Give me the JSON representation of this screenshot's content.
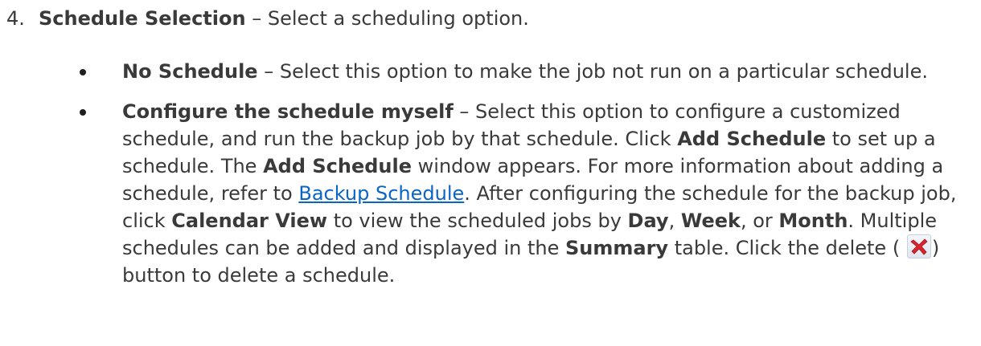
{
  "step": {
    "number": "4.",
    "title": "Schedule Selection",
    "text": " – Select a scheduling option."
  },
  "options": [
    {
      "term": "No Schedule",
      "text": " – Select this option to make the job not run on a particular schedule."
    },
    {
      "term": "Configure the schedule myself",
      "t1": " – Select this option to configure a customized schedule, and run the backup job by that schedule. Click ",
      "b1": "Add Schedule",
      "t2": " to set up a schedule. The ",
      "b2": "Add Schedule",
      "t3": " window appears. For more information about adding a schedule, refer to ",
      "link": "Backup Schedule",
      "t4": ". After configuring the schedule for the backup job, click ",
      "b3": "Calendar View",
      "t5": " to view the scheduled jobs by ",
      "b4": "Day",
      "t6": ", ",
      "b5": "Week",
      "t7": ", or ",
      "b6": "Month",
      "t8": ". Multiple schedules can be added and displayed in the ",
      "b7": "Summary",
      "t9": " table. Click the delete (",
      "t10": ") button to delete a schedule."
    }
  ],
  "icons": {
    "delete": "delete-x-icon",
    "delete_color": "#d9232d"
  },
  "colors": {
    "text": "#3a3a3a",
    "link": "#0b64c8"
  }
}
